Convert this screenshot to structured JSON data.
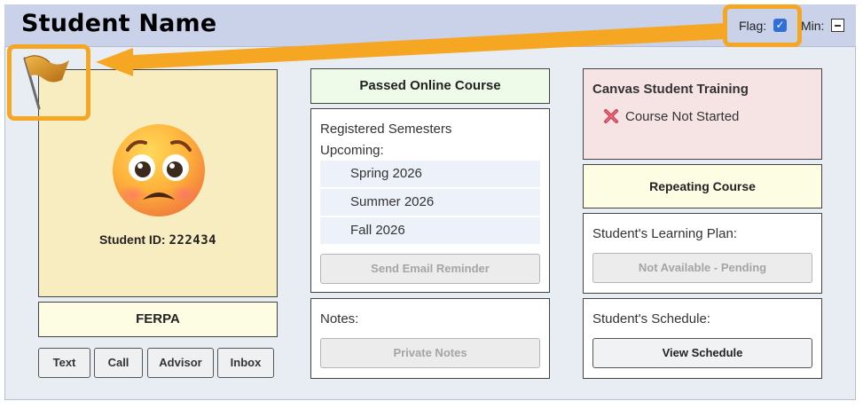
{
  "header": {
    "student_name": "Student Name",
    "flag_label": "Flag:",
    "flag_checked": true,
    "min_label": "Min:"
  },
  "profile": {
    "avatar_icon": "anxious-face-emoji",
    "student_id_label": "Student ID:",
    "student_id": "222434",
    "ferpa_label": "FERPA",
    "flag_icon": "orange-flag-icon",
    "buttons": [
      "Text",
      "Call",
      "Advisor",
      "Inbox"
    ]
  },
  "middle": {
    "passed_label": "Passed Online Course",
    "registered_label": "Registered Semesters",
    "upcoming_label": "Upcoming:",
    "semesters": [
      "Spring 2026",
      "Summer 2026",
      "Fall 2026"
    ],
    "email_button": "Send Email Reminder",
    "notes_label": "Notes:",
    "notes_button": "Private Notes"
  },
  "right": {
    "canvas_title": "Canvas Student Training",
    "canvas_status": "Course Not Started",
    "canvas_status_icon": "red-x-icon",
    "repeating_label": "Repeating Course",
    "plan_label": "Student's Learning Plan:",
    "plan_button": "Not Available - Pending",
    "schedule_label": "Student's Schedule:",
    "schedule_button": "View Schedule"
  },
  "colors": {
    "header_bg": "#c9d2e8",
    "highlight": "#f5a623",
    "checkbox": "#2f6fd6"
  }
}
